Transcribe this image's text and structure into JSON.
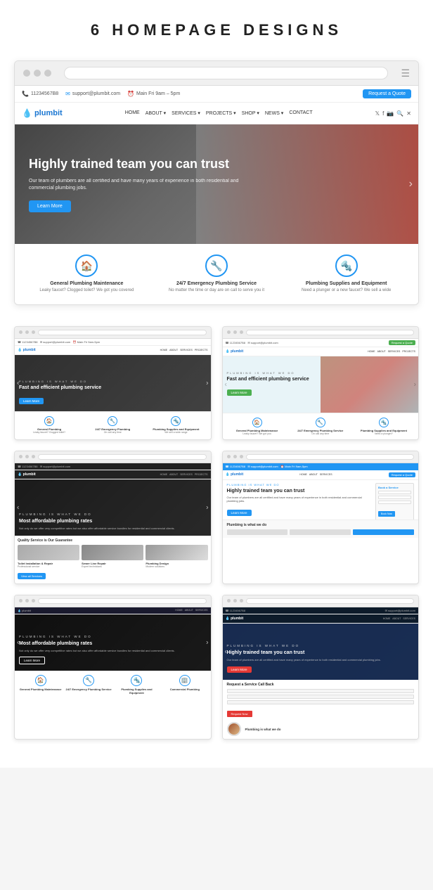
{
  "page": {
    "title": "6 HOMEPAGE DESIGNS"
  },
  "browser": {
    "url_placeholder": "",
    "menu_label": "☰"
  },
  "topbar": {
    "phone": "11234567B8",
    "email": "support@plumbit.com",
    "hours": "Main Fri 9am – 5pm",
    "cta": "Request a Quote"
  },
  "logo": {
    "name": "plumbit",
    "drop_icon": "💧"
  },
  "nav_links": [
    "HOME",
    "ABOUT ▾",
    "SERVICES ▾",
    "PROJECTS ▾",
    "SHOP ▾",
    "NEWS ▾",
    "CONTACT"
  ],
  "hero": {
    "heading": "Highly trained team you can trust",
    "body": "Our team of plumbers are all certified and have many years of experience in both residential and commercial plumbing jobs.",
    "cta": "Learn More"
  },
  "features": [
    {
      "icon": "🏠",
      "title": "General Plumbing Maintenance",
      "desc": "Leaky faucet? Clogged toilet? We got you covered"
    },
    {
      "icon": "🔧",
      "title": "24/7 Emergency Plumbing Service",
      "desc": "No matter the time or day are on call to serve you it"
    },
    {
      "icon": "🔩",
      "title": "Plumbing Supplies and Equipment",
      "desc": "Need a plunger or a new faucet? We sell a wide"
    }
  ],
  "designs": [
    {
      "id": 1,
      "type": "dark-overlay",
      "hero_heading": "Fast and efficient plumbing service",
      "hero_btn": "Learn More",
      "btn_color": "blue",
      "features": true
    },
    {
      "id": 2,
      "type": "light-right-image",
      "hero_heading": "Fast and efficient plumbing service",
      "hero_btn": "Learn More",
      "btn_color": "green",
      "features": true
    },
    {
      "id": 3,
      "type": "dark-affordable",
      "label": "PLUMBING IS WHAT WE DO",
      "hero_heading": "Most affordable plumbing rates",
      "hero_body": "Not only do we offer very competitive rates but we also offer affordable service bundles for residential and commercial clients.",
      "bottom_title": "Quality Service is Our Guarantee",
      "bottom_btn": "View all Services",
      "items": [
        "Toilet Installation & Repair",
        "Sewer Line Repair",
        "Plumbing Design"
      ]
    },
    {
      "id": 4,
      "type": "white-form",
      "label": "PLUMBING IS WHAT WE DO",
      "hero_heading": "Highly trained team you can trust",
      "hero_body": "Our team of plumbers are all certified and have many years of experience in both residential and commercial plumbing jobs.",
      "hero_btn": "Learn More",
      "form_title": "Book a Service",
      "form_btn": "Book Now",
      "bottom_label": "Plumbing is what we do"
    },
    {
      "id": 5,
      "type": "dark-affordable-2",
      "label": "PLUMBING IS WHAT WE DO",
      "hero_heading": "Most affordable plumbing rates",
      "hero_body": "Not only do we offer very competitive rates but we also offer affordable service bundles for residential and commercial clients.",
      "hero_btn": "Learn More",
      "features": [
        "General Plumbing Maintenance",
        "24/7 Emergency Plumbing Service",
        "Plumbing Supplies and Equipment",
        "Commercial Plumbing"
      ]
    },
    {
      "id": 6,
      "type": "dark-blue-form",
      "label": "PLUMBING IS WHAT WE DO",
      "hero_heading": "Highly trained team you can trust",
      "hero_body": "Our team of plumbers are all certified and have many years of experience to both residential and commercial plumbing jobs.",
      "hero_btn": "Learn More",
      "form_title": "Request a Service Call Back",
      "form_btn": "Request Now",
      "bottom_label": "Plumbing is what we do"
    }
  ]
}
